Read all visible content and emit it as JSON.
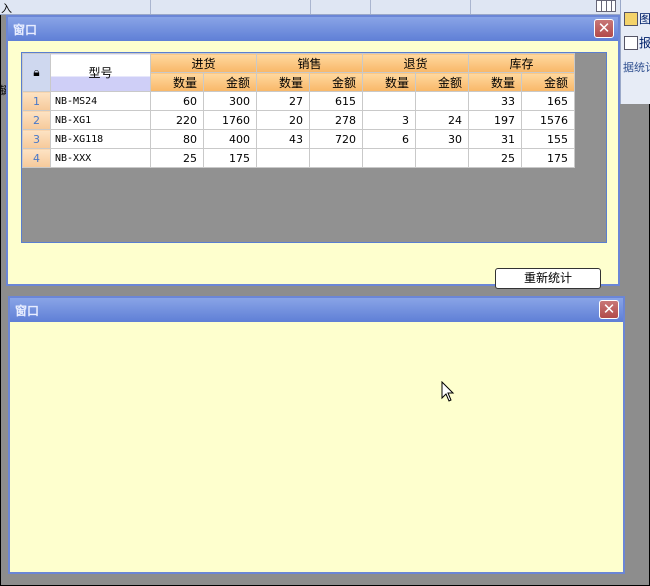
{
  "background": {
    "fragments": [
      "入",
      "键"
    ],
    "right_panel": {
      "items": [
        "图",
        "报"
      ],
      "hint": "据统计"
    }
  },
  "window1": {
    "title": "窗口",
    "close_glyph": "✕",
    "table": {
      "corner_icon": "lock-icon",
      "model_header": "型号",
      "groups": [
        "进货",
        "销售",
        "退货",
        "库存"
      ],
      "sub_headers": [
        "数量",
        "金额"
      ],
      "rows": [
        {
          "no": "1",
          "model": "NB-MS24",
          "values": [
            "60",
            "300",
            "27",
            "615",
            "",
            "",
            "33",
            "165"
          ]
        },
        {
          "no": "2",
          "model": "NB-XG1",
          "values": [
            "220",
            "1760",
            "20",
            "278",
            "3",
            "24",
            "197",
            "1576"
          ]
        },
        {
          "no": "3",
          "model": "NB-XG118",
          "values": [
            "80",
            "400",
            "43",
            "720",
            "6",
            "30",
            "31",
            "155"
          ]
        },
        {
          "no": "4",
          "model": "NB-XXX",
          "values": [
            "25",
            "175",
            "",
            "",
            "",
            "",
            "25",
            "175"
          ]
        }
      ]
    },
    "recalc_button": "重新统计"
  },
  "window2": {
    "title": "窗口",
    "close_glyph": "✕"
  },
  "colors": {
    "title_bar": "#6b86d6",
    "window_bg": "#feffce",
    "header_bg": "#f8b768",
    "close_bg": "#b24a4a"
  }
}
